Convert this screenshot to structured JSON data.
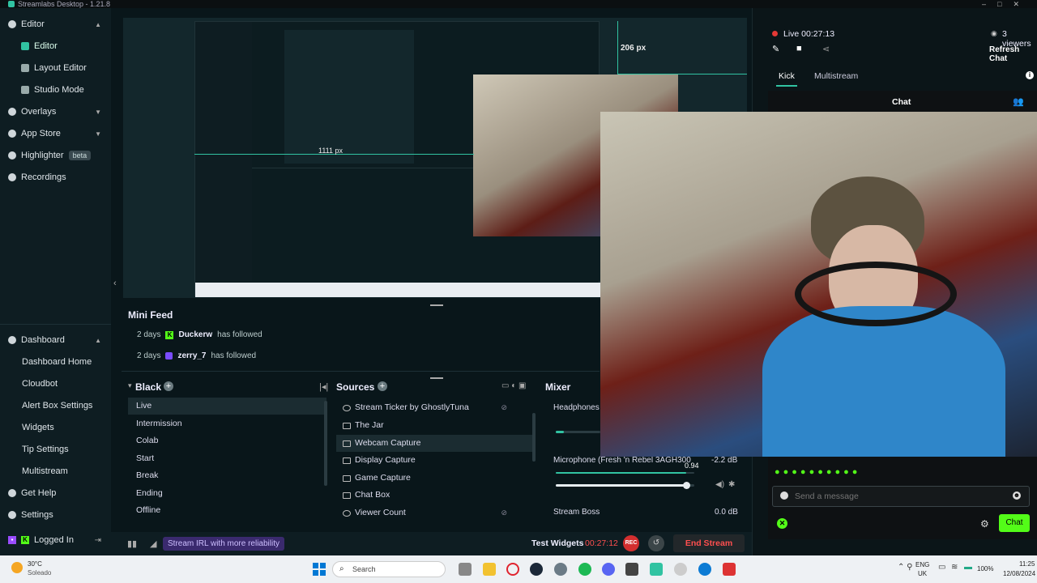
{
  "app": {
    "title": "Streamlabs Desktop - 1.21.8"
  },
  "sidebar": {
    "items": [
      {
        "label": "Editor",
        "icon": "pencil-icon"
      },
      {
        "label": "Editor",
        "icon": "editor-icon"
      },
      {
        "label": "Layout Editor",
        "icon": "layout-icon"
      },
      {
        "label": "Studio Mode",
        "icon": "studio-icon"
      },
      {
        "label": "Overlays",
        "icon": "overlays-icon"
      },
      {
        "label": "App Store",
        "icon": "store-icon"
      },
      {
        "label": "Highlighter",
        "badge": "beta",
        "icon": "highlighter-icon"
      },
      {
        "label": "Recordings",
        "icon": "recordings-icon"
      },
      {
        "label": "Dashboard",
        "icon": "dashboard-icon"
      },
      {
        "label": "Dashboard Home"
      },
      {
        "label": "Cloudbot"
      },
      {
        "label": "Alert Box Settings"
      },
      {
        "label": "Widgets"
      },
      {
        "label": "Tip Settings"
      },
      {
        "label": "Multistream"
      },
      {
        "label": "Get Help",
        "icon": "help-icon"
      },
      {
        "label": "Settings",
        "icon": "gear-icon"
      },
      {
        "label": "Logged In",
        "icon": "kick-icon"
      }
    ]
  },
  "preview": {
    "width_label": "206 px",
    "height_label": "1111 px"
  },
  "mini_feed": {
    "title": "Mini Feed",
    "rows": [
      {
        "time": "2 days",
        "user": "Duckerw",
        "action": "has followed"
      },
      {
        "time": "2 days",
        "user": "zerry_7",
        "action": "has followed"
      }
    ]
  },
  "scenes": {
    "title": "Black",
    "items": [
      "Live",
      "Intermission",
      "Colab",
      "Start",
      "Break",
      "Ending",
      "Offline"
    ]
  },
  "sources": {
    "title": "Sources",
    "items": [
      "Stream Ticker by GhostlyTuna",
      "The Jar",
      "Webcam Capture",
      "Display Capture",
      "Game Capture",
      "Chat Box",
      "Viewer Count"
    ]
  },
  "mixer": {
    "title": "Mixer",
    "items": [
      {
        "name": "Headphones (",
        "level": 0.18
      },
      {
        "name": "Microphone (Fresh 'n Rebel 3AGH300",
        "db": "-2.2 dB",
        "peak": "0.94",
        "level": 0.94
      },
      {
        "name": "Stream Boss",
        "db": "0.0 dB",
        "level": 0.0
      }
    ]
  },
  "footer": {
    "promo": "Stream IRL with more reliability",
    "test_widgets": "Test Widgets",
    "timer": "00:27:12",
    "rec": "REC",
    "end_stream": "End Stream"
  },
  "chat": {
    "status": "Live 00:27:13",
    "viewers": "3 viewers",
    "refresh": "Refresh Chat",
    "tabs": [
      "Kick",
      "Multistream"
    ],
    "header": "Chat",
    "placeholder": "Send a message",
    "send": "Chat"
  },
  "taskbar": {
    "weather_temp": "30°C",
    "weather_desc": "Soleado",
    "search": "Search",
    "lang": "ENG",
    "region": "UK",
    "battery": "100%",
    "time": "11:25",
    "date": "12/08/2024"
  },
  "colors": {
    "accent": "#31c3a2",
    "kick": "#53fc18",
    "end": "#ff4f4f",
    "bg": "#09161a"
  }
}
